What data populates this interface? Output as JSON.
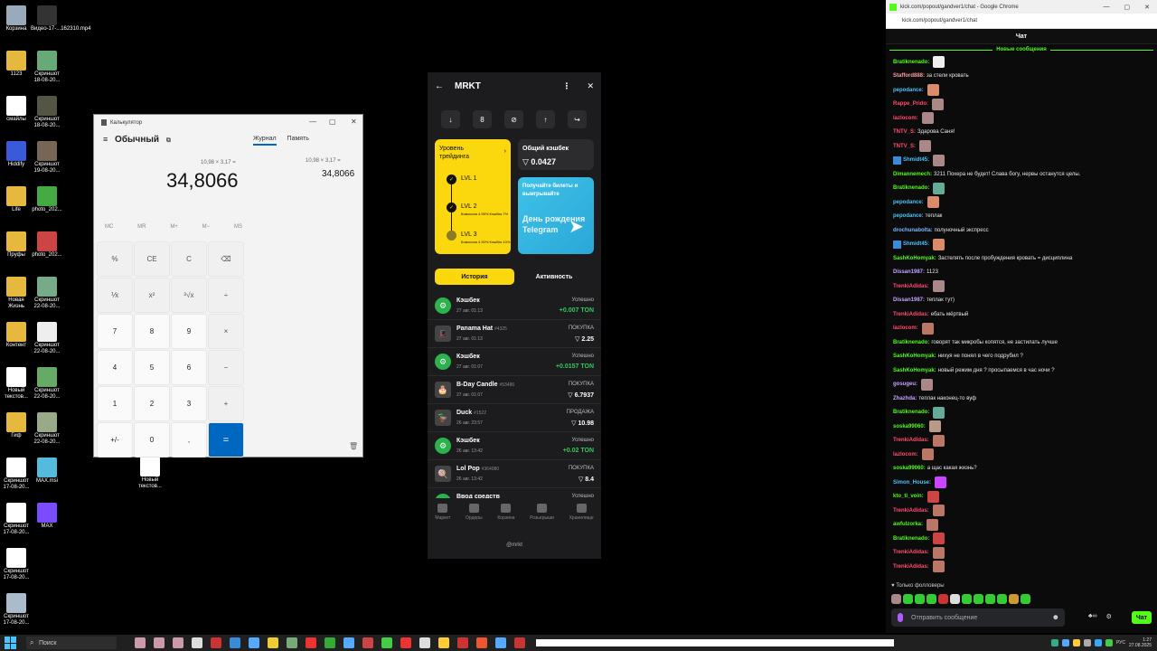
{
  "desktop": {
    "icons": [
      {
        "label": "Корзина",
        "color": "#9ab"
      },
      {
        "label": "Видео-17-...162310.mp4",
        "color": "#333"
      },
      {
        "label": "1123",
        "color": "#e6b93e"
      },
      {
        "label": "Скриншот 18-08-20...",
        "color": "#6a7"
      },
      {
        "label": "смайлы",
        "color": "#fff"
      },
      {
        "label": "Скриншот 18-08-20...",
        "color": "#554"
      },
      {
        "label": "Hiddify",
        "color": "#3a5bd9"
      },
      {
        "label": "Скриншот 19-08-20...",
        "color": "#765"
      },
      {
        "label": "Life",
        "color": "#e6b93e"
      },
      {
        "label": "photo_202...",
        "color": "#4a4"
      },
      {
        "label": "Пруфы",
        "color": "#e6b93e"
      },
      {
        "label": "photo_202...",
        "color": "#c44"
      },
      {
        "label": "Новая Жизнь",
        "color": "#e6b93e"
      },
      {
        "label": "Скриншот 22-08-20...",
        "color": "#7a8"
      },
      {
        "label": "Контент",
        "color": "#e6b93e"
      },
      {
        "label": "Скриншот 22-08-20...",
        "color": "#eee"
      },
      {
        "label": "Новый текстов...",
        "color": "#fff"
      },
      {
        "label": "Скриншот 22-08-20...",
        "color": "#6a6"
      },
      {
        "label": "Гиф",
        "color": "#e6b93e"
      },
      {
        "label": "Скриншот 22-08-20...",
        "color": "#9a8"
      },
      {
        "label": "Скриншот 17-08-20...",
        "color": "#fff"
      },
      {
        "label": "MAX.msi",
        "color": "#5bd"
      },
      {
        "label": "Новый текстов...",
        "color": "#fff"
      },
      {
        "label": "Скриншот 17-08-20...",
        "color": "#fff"
      },
      {
        "label": "MAX",
        "color": "#7b4cff"
      },
      {
        "label": "Скриншот 17-08-20...",
        "color": "#fff"
      },
      {
        "label": "Скриншот 17-08-20...",
        "color": "#abc"
      }
    ]
  },
  "calculator": {
    "window_title": "Калькулятор",
    "mode": "Обычный",
    "tab_history": "Журнал",
    "tab_memory": "Память",
    "expression": "10,98 × 3,17 =",
    "result": "34,8066",
    "history_expression": "10,98 × 3,17 =",
    "history_result": "34,8066",
    "memory": [
      "MC",
      "MR",
      "M+",
      "M−",
      "MS"
    ],
    "keys": [
      "%",
      "CE",
      "C",
      "⌫",
      "⅟x",
      "x²",
      "²√x",
      "÷",
      "7",
      "8",
      "9",
      "×",
      "4",
      "5",
      "6",
      "−",
      "1",
      "2",
      "3",
      "+",
      "+/-",
      "0",
      ",",
      "="
    ]
  },
  "mrkt": {
    "title": "MRKT",
    "level_title": "Уровень трейдинга",
    "levels": [
      {
        "name": "LVL 1",
        "sub": ""
      },
      {
        "name": "LVL 2",
        "sub": "Комиссия 4.95% Кэшбек 7%"
      },
      {
        "name": "LVL 3",
        "sub": "Комиссия 4.90% Кэшбек 10%"
      }
    ],
    "cashback_title": "Общий кэшбек",
    "cashback_value": "▽ 0.0427",
    "promo_text": "Получайте билеты и выигрывайте",
    "promo_big": "День рождения Telegram",
    "tab_history": "История",
    "tab_activity": "Активность",
    "history": [
      {
        "name": "Кэшбек",
        "num": "",
        "date": "27 авг. 01:13",
        "status": "Успешно",
        "amount": "+0.007 TON",
        "green": true,
        "icon": "⚙"
      },
      {
        "name": "Panama Hat",
        "num": "#4325",
        "date": "27 авг. 01:13",
        "status": "ПОКУПКА",
        "amount": "▽ 2.25",
        "green": false,
        "icon": "🎩"
      },
      {
        "name": "Кэшбек",
        "num": "",
        "date": "27 авг. 01:07",
        "status": "Успешно",
        "amount": "+0.0157 TON",
        "green": true,
        "icon": "⚙"
      },
      {
        "name": "B-Day Candle",
        "num": "#53486",
        "date": "27 авг. 01:07",
        "status": "ПОКУПКА",
        "amount": "▽ 6.7937",
        "green": false,
        "icon": "🎂"
      },
      {
        "name": "Duck",
        "num": "#1522",
        "date": "26 авг. 23:57",
        "status": "ПРОДАЖА",
        "amount": "▽ 10.98",
        "green": false,
        "icon": "🦆"
      },
      {
        "name": "Кэшбек",
        "num": "",
        "date": "26 авг. 13:42",
        "status": "Успешно",
        "amount": "+0.02 TON",
        "green": true,
        "icon": "⚙"
      },
      {
        "name": "Lol Pop",
        "num": "#364080",
        "date": "26 авг. 13:42",
        "status": "ПОКУПКА",
        "amount": "▽ 8.4",
        "green": false,
        "icon": "🍭"
      },
      {
        "name": "Ввод средств",
        "num": "",
        "date": "",
        "status": "Успешно",
        "amount": "",
        "green": true,
        "icon": "⬇"
      }
    ],
    "nav": [
      "Маркет",
      "Ордеры",
      "Корзина",
      "Розыгрыши",
      "Хранилище"
    ],
    "footer": "@mrkt"
  },
  "chrome": {
    "title": "kick.com/popout/gandver1/chat - Google Chrome",
    "url": "kick.com/popout/gandver1/chat",
    "chat_title": "Чат",
    "new_messages": "Новые сообщения",
    "messages": [
      {
        "user": "Bratiknenado:",
        "color": "#53fc18",
        "text": "",
        "emote": "#eee",
        "badge": false
      },
      {
        "user": "Stafford888:",
        "color": "#ff9aa2",
        "text": "за стели кровать",
        "emote": "",
        "badge": false
      },
      {
        "user": "pepodance:",
        "color": "#4fc3f7",
        "text": "",
        "emote": "#d98b6a",
        "badge": false
      },
      {
        "user": "Rappe_Prido:",
        "color": "#ff4d6d",
        "text": "",
        "emote": "#a88",
        "badge": false
      },
      {
        "user": "lazlocom:",
        "color": "#ff4d6d",
        "text": "",
        "emote": "#a88",
        "badge": false
      },
      {
        "user": "TNTV_S:",
        "color": "#ff4d6d",
        "text": "Здарова Саня!",
        "emote": "",
        "badge": false
      },
      {
        "user": "TNTV_S:",
        "color": "#ff4d6d",
        "text": "",
        "emote": "#a88",
        "badge": false
      },
      {
        "user": "Shmidt45:",
        "color": "#4fc3f7",
        "text": "",
        "emote": "#a88",
        "badge": true
      },
      {
        "user": "Dimannemech:",
        "color": "#53fc18",
        "text": "3211 Похера не будет! Слава богу, нервы останутся целы.",
        "emote": "",
        "badge": false
      },
      {
        "user": "Bratiknenado:",
        "color": "#53fc18",
        "text": "",
        "emote": "#6a9",
        "badge": false
      },
      {
        "user": "pepodance:",
        "color": "#4fc3f7",
        "text": "",
        "emote": "#d98b6a",
        "badge": false
      },
      {
        "user": "pepodance:",
        "color": "#4fc3f7",
        "text": "теплак",
        "emote": "",
        "badge": false
      },
      {
        "user": "drochunabolta:",
        "color": "#7fb5ff",
        "text": "полуночный экспресс",
        "emote": "",
        "badge": false
      },
      {
        "user": "Shmidt45:",
        "color": "#4fc3f7",
        "text": "",
        "emote": "#d98b6a",
        "badge": true
      },
      {
        "user": "SashKoHomyak:",
        "color": "#53fc18",
        "text": "Застелять после пробуждения кровать = дисциплина",
        "emote": "",
        "badge": false
      },
      {
        "user": "Dissan1987:",
        "color": "#c9a0ff",
        "text": "1123",
        "emote": "",
        "badge": false
      },
      {
        "user": "TrenkiAdidas:",
        "color": "#ff4d6d",
        "text": "",
        "emote": "#a88",
        "badge": false
      },
      {
        "user": "Dissan1987:",
        "color": "#c9a0ff",
        "text": "теплак тут)",
        "emote": "",
        "badge": false
      },
      {
        "user": "TrenkiAdidas:",
        "color": "#ff4d6d",
        "text": "ебать мёртвый",
        "emote": "",
        "badge": false
      },
      {
        "user": "lazlocom:",
        "color": "#ff4d6d",
        "text": "",
        "emote": "#b76",
        "badge": false
      },
      {
        "user": "Bratiknenado:",
        "color": "#53fc18",
        "text": "говорят так микробы копятся, не застилать лучше",
        "emote": "",
        "badge": false
      },
      {
        "user": "SashKoHomyak:",
        "color": "#53fc18",
        "text": "нихуя не понял в чего подрубил ?",
        "emote": "",
        "badge": false
      },
      {
        "user": "SashKoHomyak:",
        "color": "#53fc18",
        "text": "новый режим дня ? просыпаемся в час ночи ?",
        "emote": "",
        "badge": false
      },
      {
        "user": "gosugeu:",
        "color": "#c9a0ff",
        "text": "",
        "emote": "#a88",
        "badge": false
      },
      {
        "user": "Zhazhda:",
        "color": "#c9a0ff",
        "text": "теплак наконец-то вуф",
        "emote": "",
        "badge": false
      },
      {
        "user": "Bratiknenado:",
        "color": "#53fc18",
        "text": "",
        "emote": "#6a9",
        "badge": false
      },
      {
        "user": "soska99060:",
        "color": "#53fc18",
        "text": "",
        "emote": "#b98",
        "badge": false
      },
      {
        "user": "TrenkiAdidas:",
        "color": "#ff4d6d",
        "text": "",
        "emote": "#b76",
        "badge": false
      },
      {
        "user": "lazlocom:",
        "color": "#ff4d6d",
        "text": "",
        "emote": "#b76",
        "badge": false
      },
      {
        "user": "soska99060:",
        "color": "#53fc18",
        "text": "а щас какая жизнь?",
        "emote": "",
        "badge": false
      },
      {
        "user": "Simon_House:",
        "color": "#4fc3f7",
        "text": "",
        "emote": "#c4f",
        "badge": false
      },
      {
        "user": "kto_ti_voin:",
        "color": "#53fc18",
        "text": "",
        "emote": "#c44",
        "badge": false
      },
      {
        "user": "TrenkiAdidas:",
        "color": "#ff4d6d",
        "text": "",
        "emote": "#b76",
        "badge": false
      },
      {
        "user": "awfulzorka:",
        "color": "#53fc18",
        "text": "",
        "emote": "#b76",
        "badge": false
      },
      {
        "user": "Bratiknenado:",
        "color": "#53fc18",
        "text": "",
        "emote": "#c44",
        "badge": false
      },
      {
        "user": "TrenkiAdidas:",
        "color": "#ff4d6d",
        "text": "",
        "emote": "#b76",
        "badge": false
      },
      {
        "user": "TrenkiAdidas:",
        "color": "#ff4d6d",
        "text": "",
        "emote": "#b76",
        "badge": false
      }
    ],
    "followers_only": "♥ Только фолловеры",
    "input_placeholder": "Отправить сообщение",
    "send_label": "Чат"
  },
  "taskbar": {
    "search": "Поиск",
    "lang": "РУС",
    "time": "1:27",
    "date": "27.08.2025"
  }
}
